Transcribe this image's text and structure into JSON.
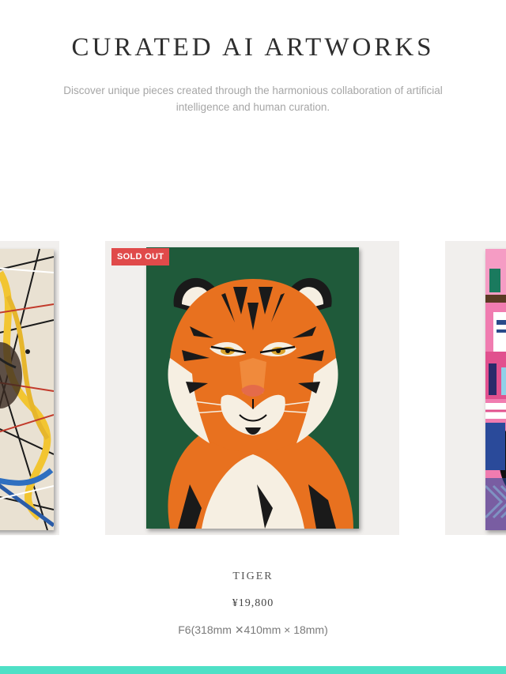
{
  "header": {
    "title": "CURATED AI ARTWORKS",
    "subtitle_line1": "Discover unique pieces created through the harmonious collaboration of artificial",
    "subtitle_line2": "intelligence and human curation."
  },
  "carousel": {
    "center_item": {
      "badge": "SOLD OUT",
      "name": "TIGER",
      "price": "¥19,800",
      "size": "F6(318mm ✕410mm × 18mm)"
    }
  },
  "colors": {
    "accent_bar": "#4fe0c6",
    "sold_out_badge": "#e04a4a",
    "tiger_background": "#1f5a3a",
    "card_background": "#f1efed"
  }
}
